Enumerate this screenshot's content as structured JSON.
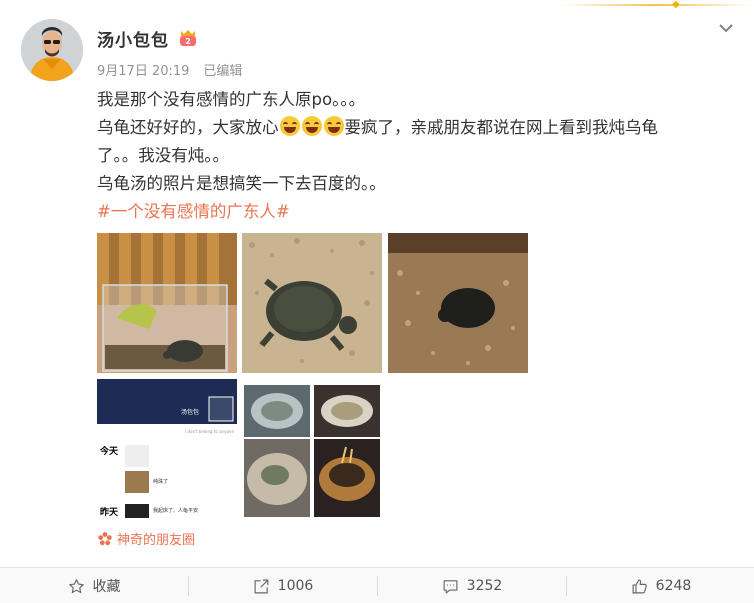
{
  "post": {
    "username": "汤小包包",
    "date": "9月17日 20:19",
    "edited": "已编辑",
    "line1": "我是那个没有感情的广东人原po。。。",
    "line2a": "乌龟还好好的，大家放心",
    "line2b": "要疯了，亲戚朋友都说在网上看到我炖乌龟",
    "line3": "了。。我没有炖。。",
    "line4": "乌龟汤的照片是想搞笑一下去百度的。。",
    "hashtag": "#一个没有感情的广东人#",
    "source": "神奇的朋友圈"
  },
  "screenshot_thumb": {
    "name": "汤包包",
    "motto": "I don't belong to anyone",
    "today": "今天",
    "today_note": "纯珠了",
    "yesterday": "昨天",
    "yesterday_note": "我起床了。人龟平安"
  },
  "footer": {
    "favorite": "收藏",
    "share": "1006",
    "comment": "3252",
    "like": "6248"
  },
  "colors": {
    "accent": "#eb7350",
    "text": "#333333",
    "meta": "#939393"
  }
}
